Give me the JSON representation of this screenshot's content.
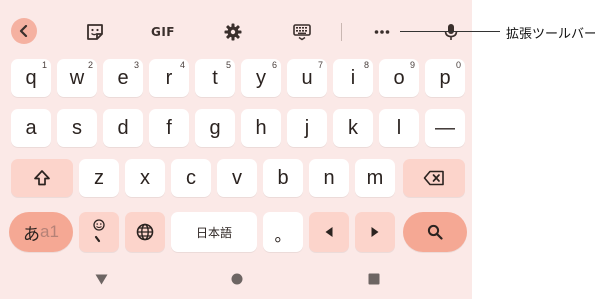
{
  "toolbar": {
    "gif_label": "GIF",
    "icons": [
      "chevron-left-icon",
      "sticker-icon",
      "gear-icon",
      "keyboard-icon",
      "more-icon",
      "microphone-icon"
    ]
  },
  "annotation": {
    "label": "拡張ツールバー"
  },
  "rows": {
    "row1": [
      {
        "char": "q",
        "num": "1"
      },
      {
        "char": "w",
        "num": "2"
      },
      {
        "char": "e",
        "num": "3"
      },
      {
        "char": "r",
        "num": "4"
      },
      {
        "char": "t",
        "num": "5"
      },
      {
        "char": "y",
        "num": "6"
      },
      {
        "char": "u",
        "num": "7"
      },
      {
        "char": "i",
        "num": "8"
      },
      {
        "char": "o",
        "num": "9"
      },
      {
        "char": "p",
        "num": "0"
      }
    ],
    "row2": [
      "a",
      "s",
      "d",
      "f",
      "g",
      "h",
      "j",
      "k",
      "l",
      "—"
    ],
    "row3": [
      "z",
      "x",
      "c",
      "v",
      "b",
      "n",
      "m"
    ]
  },
  "bottom_row": {
    "mode_kana": "あ",
    "mode_alpha": "a1",
    "space_label": "日本語",
    "period_label": "。"
  },
  "colors": {
    "keyboard_bg": "#fbe9e7",
    "key_bg": "#ffffff",
    "special_key_bg": "#fcd4cb",
    "accent": "#f5a894"
  }
}
